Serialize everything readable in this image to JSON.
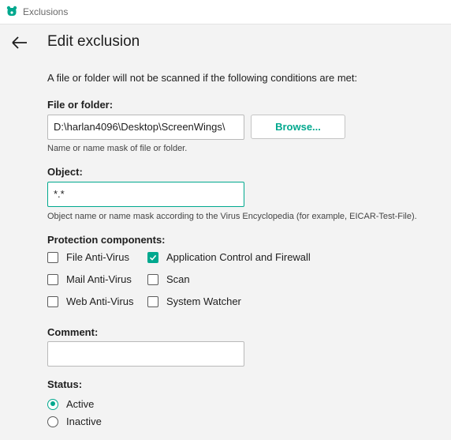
{
  "window": {
    "title": "Exclusions"
  },
  "page": {
    "title": "Edit exclusion",
    "intro": "A file or folder will not be scanned if the following conditions are met:"
  },
  "file_or_folder": {
    "label": "File or folder:",
    "value": "D:\\harlan4096\\Desktop\\ScreenWings\\",
    "browse_label": "Browse...",
    "hint": "Name or name mask of file or folder."
  },
  "object": {
    "label": "Object:",
    "value": "*.*",
    "hint": "Object name or name mask according to the Virus Encyclopedia (for example, EICAR-Test-File)."
  },
  "protection": {
    "label": "Protection components:",
    "items": [
      {
        "label": "File Anti-Virus",
        "checked": false
      },
      {
        "label": "Application Control and Firewall",
        "checked": true
      },
      {
        "label": "Mail Anti-Virus",
        "checked": false
      },
      {
        "label": "Scan",
        "checked": false
      },
      {
        "label": "Web Anti-Virus",
        "checked": false
      },
      {
        "label": "System Watcher",
        "checked": false
      }
    ]
  },
  "comment": {
    "label": "Comment:",
    "value": ""
  },
  "status": {
    "label": "Status:",
    "options": [
      {
        "label": "Active",
        "selected": true
      },
      {
        "label": "Inactive",
        "selected": false
      }
    ]
  },
  "colors": {
    "accent": "#00a88e",
    "background": "#f3f3f3"
  },
  "icons": {
    "app": "kaspersky-bear-icon",
    "back": "back-arrow-icon",
    "check": "checkmark-icon"
  }
}
